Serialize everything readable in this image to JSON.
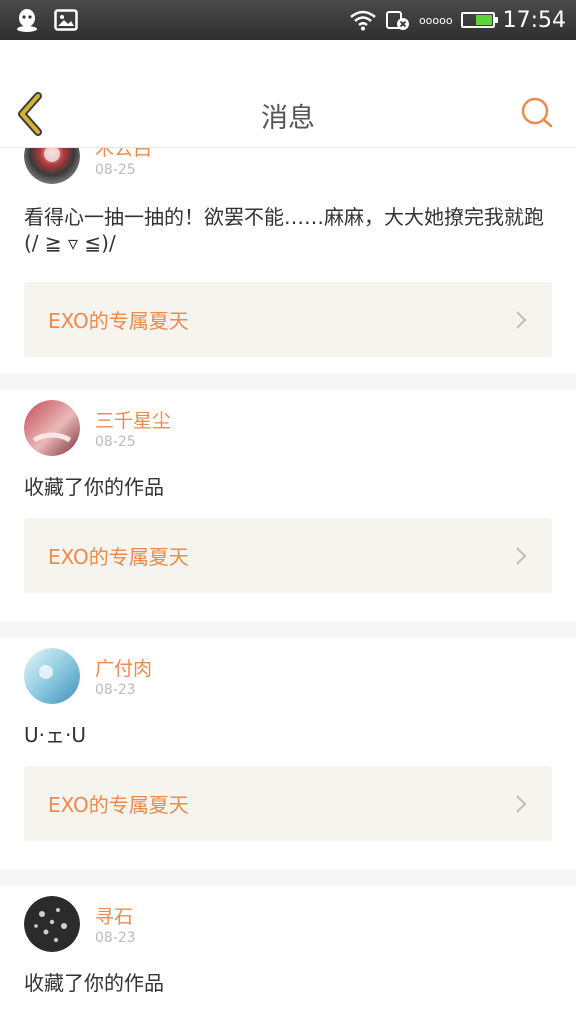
{
  "status_bar": {
    "time": "17:54",
    "signal_dots": "ooooo"
  },
  "header": {
    "title": "消息",
    "accent_color": "#f08a4b",
    "back_color": "#d6b22e"
  },
  "messages": [
    {
      "username": "木公白",
      "date": "08-25",
      "text": "看得心一抽一抽的！欲罢不能……麻麻，大大她撩完我就跑(/ ≧ ▿ ≦)/",
      "work_title": "EXO的专属夏天"
    },
    {
      "username": "三千星尘",
      "date": "08-25",
      "text": "收藏了你的作品",
      "work_title": "EXO的专属夏天"
    },
    {
      "username": "广付肉",
      "date": "08-23",
      "text": "U·ェ·U",
      "work_title": "EXO的专属夏天"
    },
    {
      "username": "寻石",
      "date": "08-23",
      "text": "收藏了你的作品",
      "work_title": ""
    }
  ]
}
